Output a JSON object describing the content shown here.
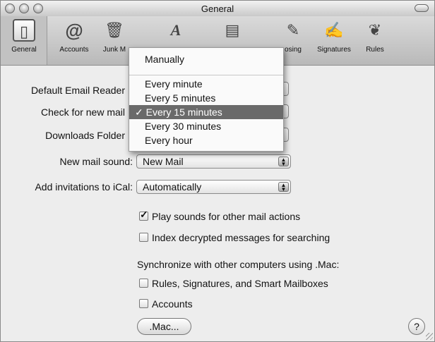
{
  "window": {
    "title": "General"
  },
  "toolbar": {
    "items": [
      {
        "label": "General",
        "icon": "general-icon"
      },
      {
        "label": "Accounts",
        "icon": "at-icon"
      },
      {
        "label": "Junk M",
        "icon": "trash-icon"
      },
      {
        "label": "",
        "icon": "font-icon"
      },
      {
        "label": "",
        "icon": "viewing-icon"
      },
      {
        "label": "osing",
        "icon": "composing-icon"
      },
      {
        "label": "Signatures",
        "icon": "signature-icon"
      },
      {
        "label": "Rules",
        "icon": "rules-icon"
      }
    ]
  },
  "form": {
    "default_email_reader_label": "Default Email Reader",
    "check_new_mail_label": "Check for new mail",
    "downloads_folder_label": "Downloads Folder",
    "new_mail_sound_label": "New mail sound:",
    "new_mail_sound_value": "New Mail",
    "add_invitations_label": "Add invitations to iCal:",
    "add_invitations_value": "Automatically"
  },
  "checkboxes": {
    "play_sounds": {
      "label": "Play sounds for other mail actions",
      "checked": true
    },
    "index_decrypted": {
      "label": "Index decrypted messages for searching",
      "checked": false
    },
    "rules_sigs": {
      "label": "Rules, Signatures, and Smart Mailboxes",
      "checked": false
    },
    "accounts": {
      "label": "Accounts",
      "checked": false
    }
  },
  "sync": {
    "label": "Synchronize with other computers using .Mac:"
  },
  "buttons": {
    "mac": ".Mac...",
    "help": "?"
  },
  "menu": {
    "items": [
      "Manually",
      "Every minute",
      "Every 5 minutes",
      "Every 15 minutes",
      "Every 30 minutes",
      "Every hour"
    ],
    "selected": "✓ Every 15 minutes"
  }
}
